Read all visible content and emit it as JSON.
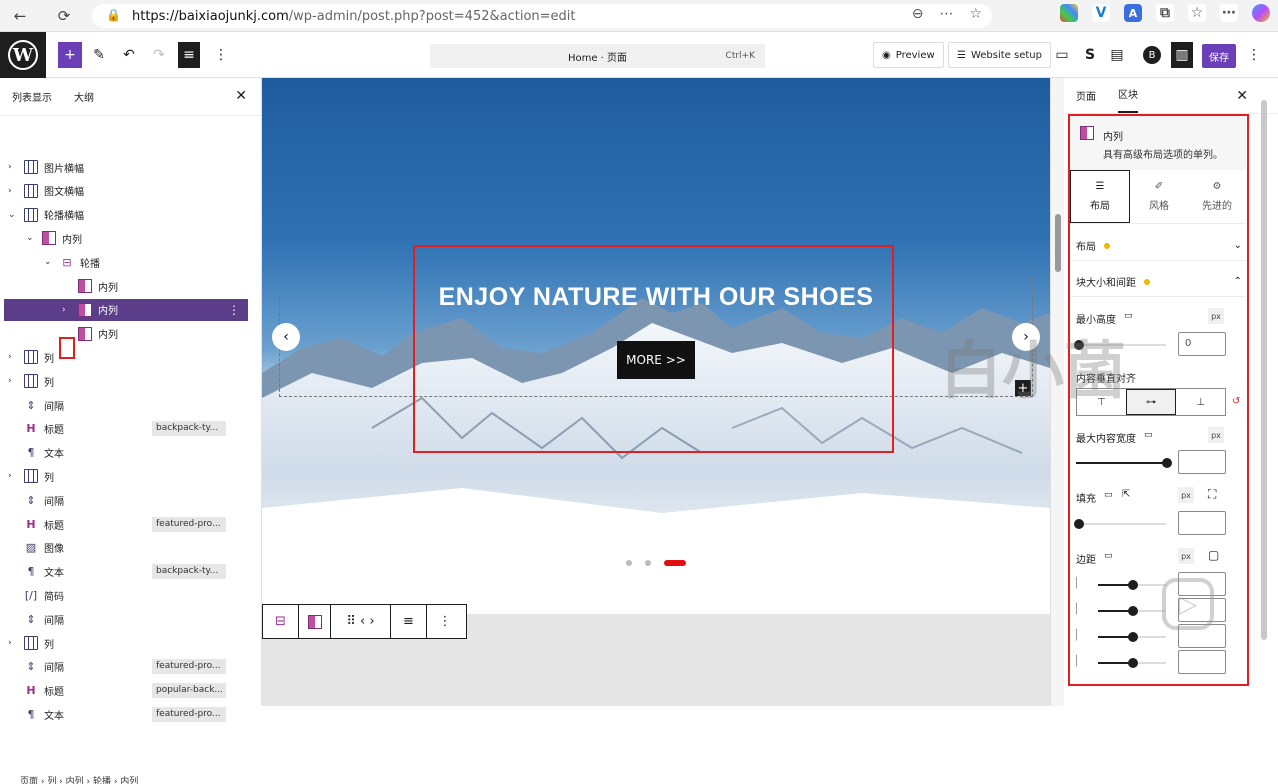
{
  "browser": {
    "url_host": "https://baixiaojunkj.com",
    "url_path": "/wp-admin/post.php?post=452&action=edit"
  },
  "toolbar": {
    "command_title": "Home · 页面",
    "command_shortcut": "Ctrl+K",
    "preview_label": "Preview",
    "website_setup_label": "Website setup",
    "save_label": "保存"
  },
  "left_panel": {
    "tab_list": "列表显示",
    "tab_outline": "大纲",
    "items": [
      {
        "label": "图片横幅",
        "icon": "columns-icon",
        "level": 0,
        "expand": "›"
      },
      {
        "label": "图文横幅",
        "icon": "columns-icon",
        "level": 0,
        "expand": "›"
      },
      {
        "label": "轮播横幅",
        "icon": "columns-icon",
        "level": 0,
        "expand": "⌄"
      },
      {
        "label": "内列",
        "icon": "inner-column-icon",
        "level": 1,
        "expand": "⌄"
      },
      {
        "label": "轮播",
        "icon": "carousel-icon",
        "level": 2,
        "expand": "⌄"
      },
      {
        "label": "内列",
        "icon": "inner-column-icon",
        "level": 3,
        "expand": ""
      },
      {
        "label": "内列",
        "icon": "inner-column-icon",
        "level": 3,
        "expand": "›",
        "selected": true
      },
      {
        "label": "内列",
        "icon": "inner-column-icon",
        "level": 3,
        "expand": ""
      },
      {
        "label": "列",
        "icon": "columns-icon",
        "level": 0,
        "expand": "›"
      },
      {
        "label": "列",
        "icon": "columns-icon",
        "level": 0,
        "expand": "›"
      },
      {
        "label": "间隔",
        "icon": "spacer-icon",
        "level": 0,
        "expand": ""
      },
      {
        "label": "标题",
        "icon": "heading-icon",
        "level": 0,
        "expand": "",
        "badge": "backpack-ty..."
      },
      {
        "label": "文本",
        "icon": "paragraph-icon",
        "level": 0,
        "expand": ""
      },
      {
        "label": "列",
        "icon": "columns-icon",
        "level": 0,
        "expand": "›"
      },
      {
        "label": "间隔",
        "icon": "spacer-icon",
        "level": 0,
        "expand": ""
      },
      {
        "label": "标题",
        "icon": "heading-icon",
        "level": 0,
        "expand": "",
        "badge": "featured-pro..."
      },
      {
        "label": "图像",
        "icon": "image-icon",
        "level": 0,
        "expand": ""
      },
      {
        "label": "文本",
        "icon": "paragraph-icon",
        "level": 0,
        "expand": "",
        "badge": "backpack-ty..."
      },
      {
        "label": "简码",
        "icon": "shortcode-icon",
        "level": 0,
        "expand": ""
      },
      {
        "label": "间隔",
        "icon": "spacer-icon",
        "level": 0,
        "expand": ""
      },
      {
        "label": "列",
        "icon": "columns-icon",
        "level": 0,
        "expand": "›"
      },
      {
        "label": "间隔",
        "icon": "spacer-icon",
        "level": 0,
        "expand": "",
        "badge": "featured-pro..."
      },
      {
        "label": "标题",
        "icon": "heading-icon",
        "level": 0,
        "expand": "",
        "badge": "popular-back..."
      },
      {
        "label": "文本",
        "icon": "paragraph-icon",
        "level": 0,
        "expand": "",
        "badge": "featured-pro..."
      }
    ],
    "breadcrumb": "页面 › 列 › 内列 › 轮播 › 内列"
  },
  "canvas": {
    "hero_title": "ENJOY NATURE WITH OUR SHOES",
    "button_label": "MORE >>",
    "slide_count": 3,
    "active_slide": 3
  },
  "right_panel": {
    "tab_page": "页面",
    "tab_block": "区块",
    "block_name": "内列",
    "block_desc": "具有高级布局选项的单列。",
    "subtabs": [
      "布局",
      "风格",
      "先进的"
    ],
    "section_layout": "布局",
    "section_size": "块大小和间距",
    "min_height_label": "最小高度",
    "min_height_value": "0",
    "unit_px": "px",
    "vertical_align_label": "内容垂直对齐",
    "max_width_label": "最大内容宽度",
    "padding_label": "填充",
    "margin_label": "边距"
  },
  "colors": {
    "accent": "#6a3fb8",
    "selected_row": "#5b3d8a",
    "highlight_red": "#e02020",
    "active_dot": "#e01010"
  }
}
